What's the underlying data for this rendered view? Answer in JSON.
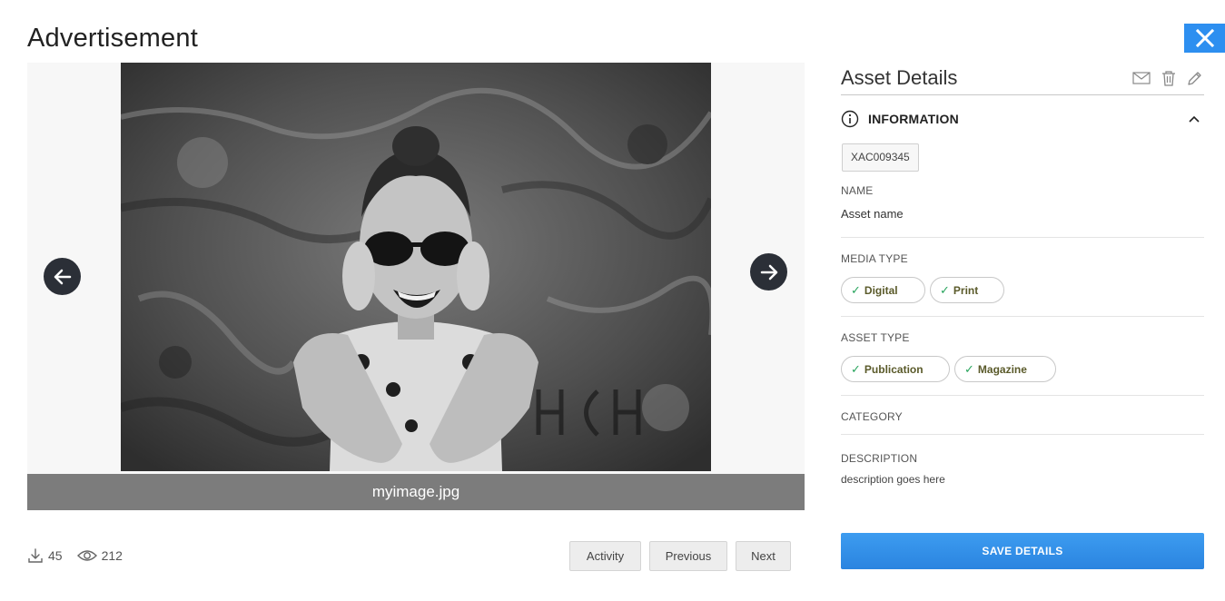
{
  "page": {
    "title": "Advertisement"
  },
  "viewer": {
    "file_name": "myimage.jpg",
    "prev_arrow_icon": "arrow-left-icon",
    "next_arrow_icon": "arrow-right-icon"
  },
  "stats": {
    "downloads": "45",
    "views": "212"
  },
  "buttons": {
    "activity": "Activity",
    "previous": "Previous",
    "next": "Next",
    "save": "SAVE DETAILS"
  },
  "panel": {
    "title": "Asset Details",
    "icons": [
      "mail-icon",
      "trash-icon",
      "pencil-icon"
    ],
    "section_title": "INFORMATION",
    "asset_id": "XAC009345",
    "name_label": "NAME",
    "name_value": "Asset name",
    "media_type_label": "MEDIA TYPE",
    "media_types": [
      "Digital",
      "Print"
    ],
    "asset_type_label": "ASSET TYPE",
    "asset_types": [
      "Publication",
      "Magazine"
    ],
    "category_label": "CATEGORY",
    "description_label": "DESCRIPTION",
    "description_value": "description goes here"
  },
  "colors": {
    "accent": "#2d8ff0",
    "check": "#2aa55e",
    "caption_bar": "#7c7c7c",
    "arrow_bg": "#2b2f37"
  }
}
